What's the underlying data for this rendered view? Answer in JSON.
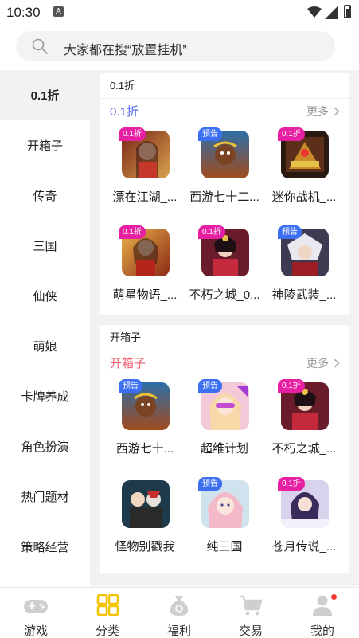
{
  "status_bar": {
    "time": "10:30",
    "notification_icon": "A"
  },
  "search": {
    "placeholder": "大家都在搜“放置挂机”"
  },
  "sidebar": {
    "items": [
      {
        "label": "0.1折",
        "active": true
      },
      {
        "label": "开箱子"
      },
      {
        "label": "传奇"
      },
      {
        "label": "三国"
      },
      {
        "label": "仙侠"
      },
      {
        "label": "萌娘"
      },
      {
        "label": "卡牌养成"
      },
      {
        "label": "角色扮演"
      },
      {
        "label": "热门题材"
      },
      {
        "label": "策略经营"
      }
    ]
  },
  "sections": [
    {
      "header": "0.1折",
      "subtitle": "0.1折",
      "subtitle_color": "#4b63f0",
      "more": "更多",
      "games": [
        {
          "name": "漂在江湖_...",
          "badge": "0.1折",
          "badge_type": "disc"
        },
        {
          "name": "西游七十二...",
          "badge": "预告",
          "badge_type": "pre"
        },
        {
          "name": "迷你战机_...",
          "badge": "0.1折",
          "badge_type": "disc"
        },
        {
          "name": "萌星物语_...",
          "badge": "0.1折",
          "badge_type": "disc"
        },
        {
          "name": "不朽之城_0...",
          "badge": "0.1折",
          "badge_type": "disc"
        },
        {
          "name": "神陵武装_...",
          "badge": "预告",
          "badge_type": "pre"
        }
      ]
    },
    {
      "header": "开箱子",
      "subtitle": "开箱子",
      "subtitle_color": "#f0606e",
      "more": "更多",
      "games": [
        {
          "name": "西游七十...",
          "badge": "预告",
          "badge_type": "pre"
        },
        {
          "name": "超维计划",
          "badge": "预告",
          "badge_type": "pre"
        },
        {
          "name": "不朽之城_...",
          "badge": "0.1折",
          "badge_type": "disc"
        },
        {
          "name": "怪物别戳我",
          "badge": "",
          "badge_type": ""
        },
        {
          "name": "纯三国",
          "badge": "预告",
          "badge_type": "pre"
        },
        {
          "name": "苍月传说_...",
          "badge": "0.1折",
          "badge_type": "disc"
        }
      ]
    }
  ],
  "tabbar": {
    "tabs": [
      {
        "label": "游戏",
        "icon": "gamepad-icon"
      },
      {
        "label": "分类",
        "icon": "category-grid-icon",
        "active": true
      },
      {
        "label": "福利",
        "icon": "money-bag-icon"
      },
      {
        "label": "交易",
        "icon": "cart-icon"
      },
      {
        "label": "我的",
        "icon": "profile-icon"
      }
    ]
  },
  "colors": {
    "accent_yellow": "#f5c400",
    "badge_discount": "#e61fa3",
    "badge_preview": "#3d6ff2",
    "dot_red": "#f03c2d"
  }
}
